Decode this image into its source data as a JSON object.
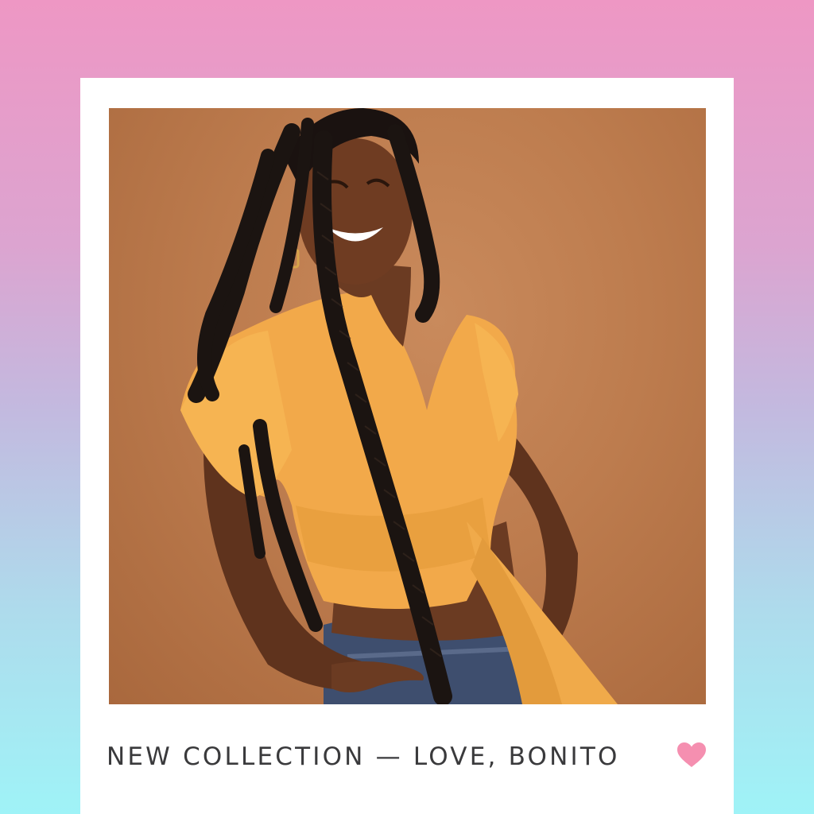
{
  "post": {
    "caption": "NEW COLLECTION — LOVE, BONITO",
    "photo_subject": "smiling woman with long braids wearing a yellow wrap crop top and denim jeans",
    "like_icon": "heart-icon"
  },
  "colors": {
    "gradient_top": "#ee97c4",
    "gradient_bottom": "#9ff3f7",
    "card": "#ffffff",
    "heart": "#f58fb0",
    "caption_text": "#3a3a3c"
  }
}
